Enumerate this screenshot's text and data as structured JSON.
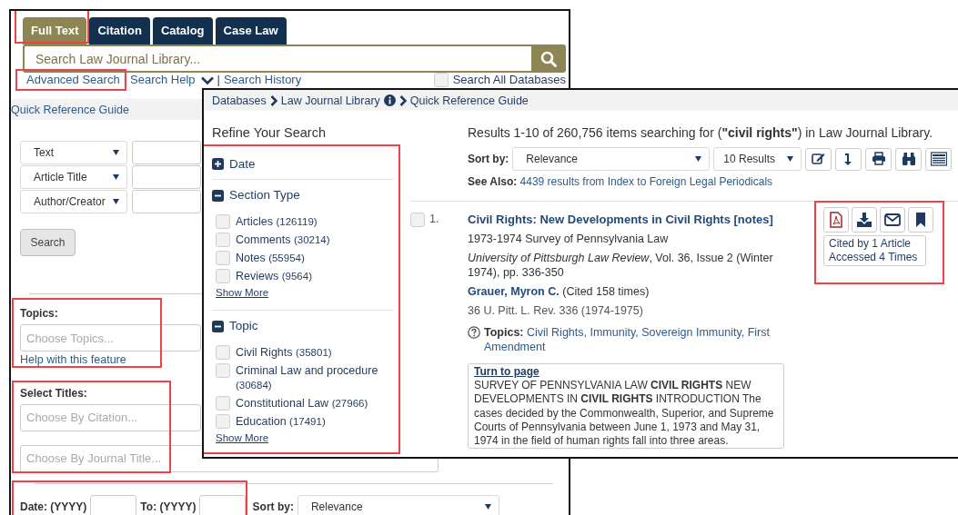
{
  "back_window": {
    "tabs": [
      {
        "label": "Full Text",
        "selected": true,
        "highlighted": true
      },
      {
        "label": "Citation",
        "selected": false,
        "highlighted": false
      },
      {
        "label": "Catalog",
        "selected": false,
        "highlighted": false
      },
      {
        "label": "Case Law",
        "selected": false,
        "highlighted": false
      }
    ],
    "search": {
      "placeholder": "Search Law Journal Library..."
    },
    "links": [
      {
        "label": "Advanced Search",
        "kind": "link",
        "highlighted": true
      },
      {
        "label": "Search Help",
        "kind": "dropdown",
        "highlighted": false
      },
      {
        "label": "Search History",
        "kind": "link",
        "highlighted": false
      }
    ],
    "link_separator": "|",
    "search_all": {
      "label": "Search All Databases",
      "checked": false
    },
    "quick_reference": "Quick Reference Guide",
    "field_rows": [
      {
        "field": "Text"
      },
      {
        "field": "Article Title"
      },
      {
        "field": "Author/Creator"
      }
    ],
    "search_button": "Search",
    "topics": {
      "label": "Topics:",
      "placeholder": "Choose Topics...",
      "help": "Help with this feature",
      "highlighted": true
    },
    "titles": {
      "label": "Select Titles:",
      "highlighted": true,
      "fields": [
        {
          "placeholder": "Choose By Citation..."
        },
        {
          "placeholder": "Choose By Journal Title..."
        }
      ]
    },
    "date": {
      "from_label": "Date: (YYYY)",
      "to_label": "To: (YYYY)",
      "highlighted": true
    },
    "sort": {
      "label": "Sort by:",
      "value": "Relevance"
    }
  },
  "front_window": {
    "breadcrumb": [
      {
        "label": "Databases",
        "info": false
      },
      {
        "label": "Law Journal Library",
        "info": true
      },
      {
        "label": "Quick Reference Guide",
        "info": false
      }
    ],
    "refine_title": "Refine Your Search",
    "facets_highlighted": true,
    "facets": [
      {
        "title": "Date",
        "expanded": false
      },
      {
        "title": "Section Type",
        "expanded": true,
        "show_more": "Show More",
        "options": [
          {
            "label": "Articles",
            "count": "(126119)",
            "checked": false
          },
          {
            "label": "Comments",
            "count": "(30214)",
            "checked": false
          },
          {
            "label": "Notes",
            "count": "(55954)",
            "checked": false
          },
          {
            "label": "Reviews",
            "count": "(9564)",
            "checked": false
          }
        ]
      },
      {
        "title": "Topic",
        "expanded": true,
        "show_more": "Show More",
        "options": [
          {
            "label": "Civil Rights",
            "count": "(35801)",
            "checked": false
          },
          {
            "label": "Criminal Law and procedure",
            "count": "(30684)",
            "checked": false
          },
          {
            "label": "Constitutional Law",
            "count": "(27966)",
            "checked": false
          },
          {
            "label": "Education",
            "count": "(17491)",
            "checked": false
          }
        ]
      }
    ],
    "results_summary": "Results 1-10 of 260,756 items searching for (**\"civil rights\"**) in Law Journal Library.",
    "sort": {
      "label": "Sort by:",
      "value": "Relevance",
      "per_page": "10 Results"
    },
    "see_also": {
      "label": "See Also:",
      "link": "4439 results from Index to Foreign Legal Periodicals"
    },
    "results": [
      {
        "number": "1.",
        "checked": false,
        "title": "Civil Rights: New Developments in Civil Rights [notes]",
        "subtitle": "1973-1974 Survey of Pennsylvania Law",
        "source": "*University of Pittsburgh Law Review*, Vol. 36, Issue 2 (Winter 1974), pp. 336-350",
        "author": "Grauer, Myron C.",
        "author_note": "(Cited 158 times)",
        "citation": "36 U. Pitt. L. Rev. 336 (1974-1975)",
        "topics_label": "Topics:",
        "topics": "Civil Rights, Immunity, Sovereign Immunity, First Amendment",
        "snippet_link": "Turn to page",
        "snippet": "SURVEY OF PENNSYLVANIA LAW **CIVIL RIGHTS** NEW DEVELOPMENTS IN **CIVIL RIGHTS** INTRODUCTION The cases decided by the Commonwealth, Superior, and Supreme Courts of Pennsylvania between June 1, 1973 and May 31, 1974 in the field of human rights fall into three areas.",
        "stats": [
          "Cited by 1 Article",
          "Accessed 4 Times"
        ],
        "actions_highlighted": true
      }
    ]
  }
}
